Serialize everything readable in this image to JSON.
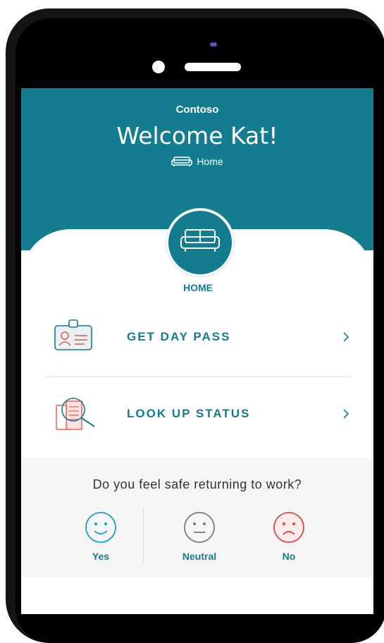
{
  "app": {
    "brand": "Contoso",
    "welcome": "Welcome Kat!",
    "location": "Home"
  },
  "hub": {
    "label": "HOME",
    "icon": "sofa-icon"
  },
  "actions": [
    {
      "label": "GET DAY PASS",
      "icon": "id-badge-icon"
    },
    {
      "label": "LOOK UP STATUS",
      "icon": "building-search-icon"
    }
  ],
  "survey": {
    "question": "Do you feel safe returning to work?",
    "options": [
      {
        "label": "Yes",
        "icon": "happy-face-icon",
        "color": "#1b9cc4"
      },
      {
        "label": "Neutral",
        "icon": "neutral-face-icon",
        "color": "#7a7a7a"
      },
      {
        "label": "No",
        "icon": "sad-face-icon",
        "color": "#e0483e"
      }
    ]
  },
  "colors": {
    "accent": "#137c8e",
    "illustration": "#e8594f"
  }
}
